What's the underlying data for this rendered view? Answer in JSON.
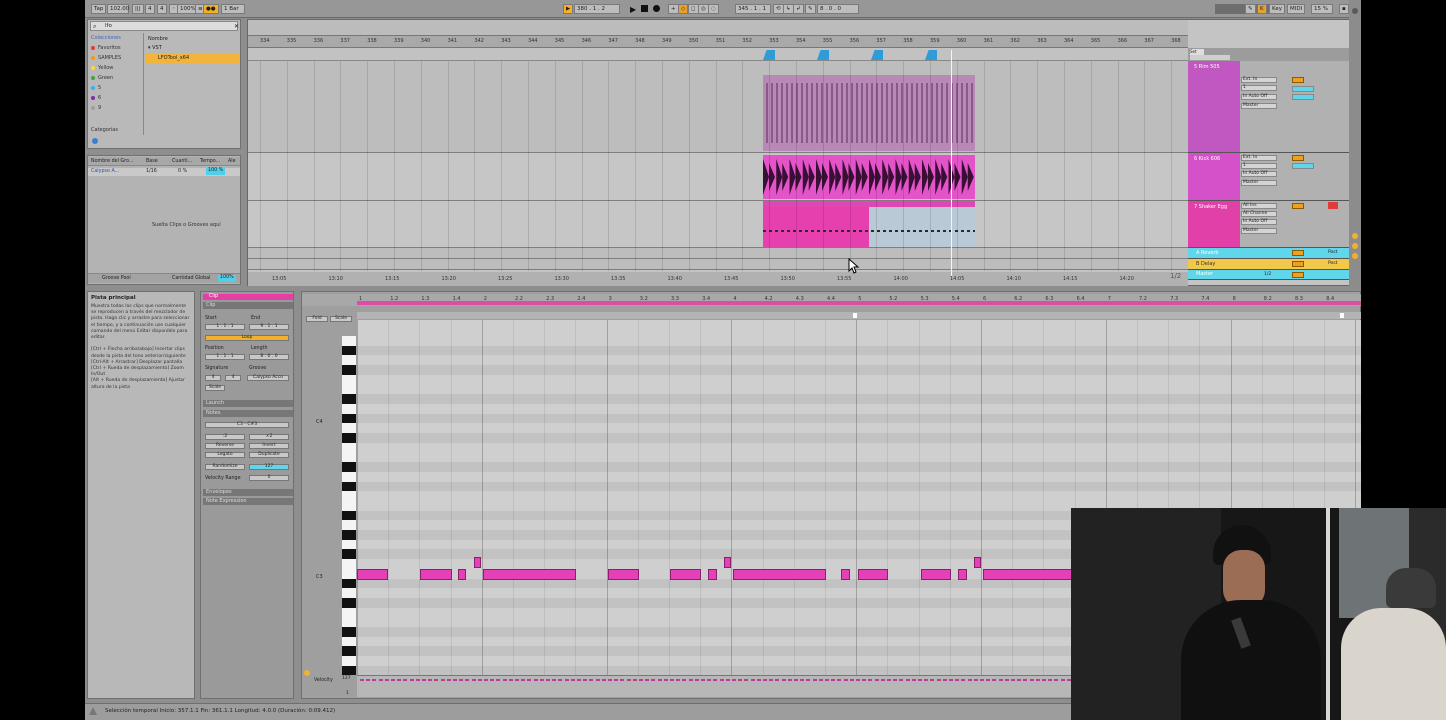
{
  "transport": {
    "tap": "Tap",
    "tempo": "102.00",
    "sig_num": "4",
    "sig_den": "4",
    "zoom": "100%",
    "quant": "1 Bar",
    "position": "380 . 1 . 2",
    "loop_start": "345 . 1 . 1",
    "loop_len": "8 . 0 . 0",
    "key_label": "Key",
    "midi_label": "MIDI",
    "cpu": "15 %"
  },
  "browser": {
    "search_value": "lfo",
    "collections_title": "Colecciones",
    "collections": [
      {
        "label": "Favoritos",
        "color": "#e53935"
      },
      {
        "label": "SAMPLES",
        "color": "#ff9800"
      },
      {
        "label": "Yellow",
        "color": "#fdd835"
      },
      {
        "label": "Green",
        "color": "#43a047"
      },
      {
        "label": "5",
        "color": "#29b6f6"
      },
      {
        "label": "6",
        "color": "#8e24aa"
      },
      {
        "label": "9",
        "color": "#9e9e9e"
      }
    ],
    "categories": "Categorías",
    "name_header": "Nombre",
    "folder": "VST",
    "result": "LFOTool_x64"
  },
  "groove": {
    "headers": [
      "Nombre del Gro...",
      "Base",
      "Cuanti...",
      "Tempo...",
      "Ale"
    ],
    "row": [
      "Calypso A...",
      "1/16",
      "0 %",
      "100 %"
    ],
    "hint": "Suelta Clips o Grooves aquí",
    "pool": "Groove Pool",
    "global_label": "Cantidad Global",
    "global_value": "100%"
  },
  "arrangement": {
    "bars": [
      "334",
      "335",
      "336",
      "337",
      "338",
      "339",
      "340",
      "341",
      "342",
      "343",
      "344",
      "345",
      "346",
      "347",
      "348",
      "349",
      "350",
      "351",
      "352",
      "353",
      "354",
      "355",
      "356",
      "357",
      "358",
      "359",
      "360",
      "361",
      "362",
      "363",
      "364",
      "365",
      "366",
      "367",
      "368"
    ],
    "times": [
      "13:05",
      "13:10",
      "13:15",
      "13:20",
      "13:25",
      "13:30",
      "13:35",
      "13:40",
      "13:45",
      "13:50",
      "13:55",
      "14:00",
      "14:05",
      "14:10",
      "14:15",
      "14:20"
    ],
    "page": "1/2"
  },
  "tracks": [
    {
      "name": "5 Rim 505",
      "input": "Ext. In",
      "ch": "1",
      "mon": "In Auto Off",
      "out": "Master",
      "color": "#d24fc3"
    },
    {
      "name": "6 Kick 606",
      "input": "Ext. In",
      "ch": "1",
      "mon": "In Auto Off",
      "out": "Master",
      "color": "#d24fc3"
    },
    {
      "name": "7 Shaker Egg",
      "input": "All Ins",
      "ch": "All Channe",
      "mon": "In Auto Off",
      "out": "Master",
      "color": "#e040a8"
    },
    {
      "name": "A Reverb",
      "out": "Post",
      "color": "#3fd0e0"
    },
    {
      "name": "B Delay",
      "out": "Post",
      "color": "#f5c840"
    },
    {
      "name": "Master",
      "out": "1/2",
      "color": "#3fd0e0"
    }
  ],
  "info_panel": {
    "title": "Pista principal",
    "body": "Muestra todas las clips que normalmente se reproducen a través del mezclador de pista. Haga clic y arrastre para seleccionar el tiempo, y a continuación use cualquier comando del menú Editar disponible para editar.\n\n[Ctrl + Flecha arriba/abajo] Insertar clips desde la pista del tono anterior/siguiente [Ctrl-Alt + Arrastrar] Desplazar pantalla [Ctrl + Rueda de desplazamiento] Zoom In/Out\n[Alt + Rueda de desplazamiento] Ajustar altura de la pista"
  },
  "clip_view": {
    "clip_title": "Clip",
    "clip_label": "Clip",
    "start": "Start",
    "end": "End",
    "loop": "Loop",
    "position": "Position",
    "length": "Length",
    "signature": "Signature",
    "groove": "Groove",
    "groove_value": "Calypso Acco",
    "sig_values": [
      "4",
      "4"
    ],
    "scale": "Scale",
    "launch": "Launch",
    "notes": "Notes",
    "range": "C3 - C#3",
    "div2": ":2",
    "mul2": "×2",
    "reverse": "Reverse",
    "invert": "Invert",
    "legato": "Legato",
    "duplicate": "Duplicate",
    "randomize": "Randomize",
    "rand_value": "127",
    "velocity_range": "Velocity Range",
    "vel_value": "0",
    "envelopes": "Envelopes",
    "note_expression": "Note Expression"
  },
  "piano_roll": {
    "fold": "Fold",
    "scale": "Scale",
    "c4": "C4",
    "c3": "C3",
    "beats": [
      "1",
      "1.2",
      "1.3",
      "1.4",
      "2",
      "2.2",
      "2.3",
      "2.4",
      "3",
      "3.2",
      "3.3",
      "3.4",
      "4",
      "4.2",
      "4.3",
      "4.4",
      "5",
      "5.2",
      "5.3",
      "5.4",
      "6",
      "6.2",
      "6.3",
      "6.4",
      "7",
      "7.2",
      "7.3",
      "7.4",
      "8",
      "8.2",
      "8.3",
      "8.4"
    ],
    "velocity_label": "Velocity",
    "vel_max": "127",
    "vel_min": "1"
  },
  "status": {
    "text": "Selección temporal   Inicio: 357.1.1   Fin: 361.1.1   Longitud: 4.0.0 (Duración: 0:09.412)"
  }
}
